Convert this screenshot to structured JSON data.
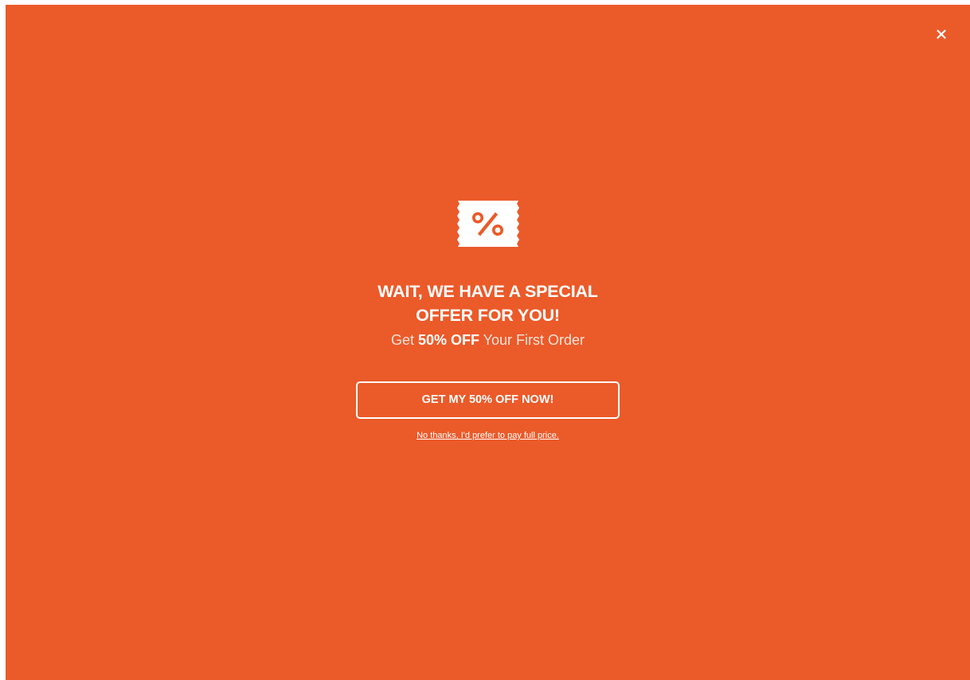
{
  "popup": {
    "background_color": "#EB5A29",
    "close_icon": "close-icon",
    "coupon_icon": "percent-coupon-icon",
    "headline_line1": "WAIT, WE HAVE A SPECIAL",
    "headline_line2": "OFFER FOR YOU!",
    "subline_prefix": "Get ",
    "subline_highlight": "50% OFF",
    "subline_suffix": " Your First Order",
    "cta_label": "GET MY 50% OFF NOW!",
    "decline_label": "No thanks, I'd prefer to pay full price."
  }
}
